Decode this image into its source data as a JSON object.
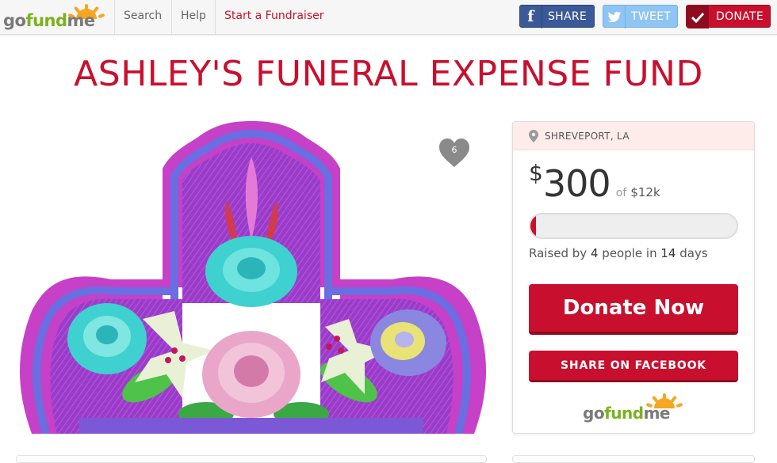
{
  "nav": {
    "logo_text_go": "go",
    "logo_text_fund": "fund",
    "logo_text_me": "me",
    "search_label": "Search",
    "help_label": "Help",
    "start_label": "Start a Fundraiser"
  },
  "social": {
    "share_label": "SHARE",
    "tweet_label": "TWEET",
    "donate_label": "DONATE"
  },
  "campaign": {
    "title": "ASHLEY'S FUNERAL EXPENSE FUND",
    "heart_count": "6"
  },
  "card": {
    "location": "SHREVEPORT, LA",
    "currency": "$",
    "raised": "300",
    "of_label": "of",
    "goal": "$12k",
    "progress_fraction": 0.025,
    "stats_prefix": "Raised by",
    "donor_count": "4",
    "stats_mid": "people in",
    "days": "14",
    "stats_suffix": "days",
    "donate_now_label": "Donate Now",
    "share_facebook_label": "SHARE ON FACEBOOK"
  },
  "colors": {
    "brand_red": "#c8102e",
    "brand_green": "#7ab21e",
    "facebook_blue": "#3b5998",
    "twitter_blue": "#8ec5f2"
  }
}
